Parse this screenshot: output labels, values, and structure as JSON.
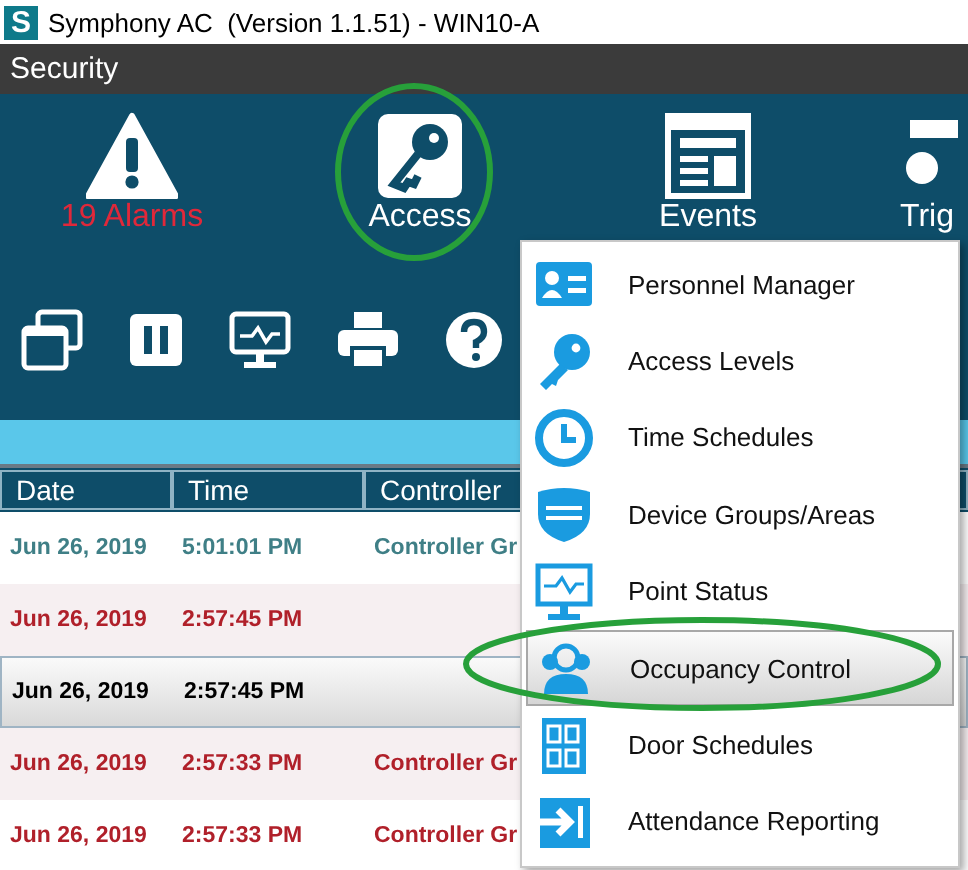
{
  "window": {
    "logo": "S",
    "title": "Symphony AC  (Version 1.1.51) - WIN10-A"
  },
  "section_bar": {
    "title": "Security"
  },
  "modules": [
    {
      "label": "19 Alarms",
      "alert": true
    },
    {
      "label": "Access",
      "alert": false
    },
    {
      "label": "Events",
      "alert": false
    },
    {
      "label": "Trig",
      "alert": false
    }
  ],
  "table": {
    "columns": [
      "Date",
      "Time",
      "Controller"
    ],
    "rows": [
      {
        "cells": [
          "Jun 26, 2019",
          "5:01:01 PM",
          "Controller Gr"
        ],
        "kind": "info",
        "selected": false
      },
      {
        "cells": [
          "Jun 26, 2019",
          "2:57:45 PM"
        ],
        "kind": "alarm",
        "selected": false
      },
      {
        "cells": [
          "Jun 26, 2019",
          "2:57:45 PM"
        ],
        "kind": "alarm",
        "selected": true
      },
      {
        "cells": [
          "Jun 26, 2019",
          "2:57:33 PM",
          "Controller Gr"
        ],
        "kind": "alarm",
        "selected": false
      },
      {
        "cells": [
          "Jun 26, 2019",
          "2:57:33 PM",
          "Controller Gr"
        ],
        "kind": "alarm",
        "selected": false
      }
    ]
  },
  "menu": {
    "items": [
      {
        "label": "Personnel Manager",
        "selected": false
      },
      {
        "label": "Access Levels",
        "selected": false
      },
      {
        "label": "Time Schedules",
        "selected": false
      },
      {
        "label": "Device Groups/Areas",
        "selected": false
      },
      {
        "label": "Point Status",
        "selected": false
      },
      {
        "label": "Occupancy Control",
        "selected": true
      },
      {
        "label": "Door Schedules",
        "selected": false
      },
      {
        "label": "Attendance Reporting",
        "selected": false
      }
    ]
  }
}
